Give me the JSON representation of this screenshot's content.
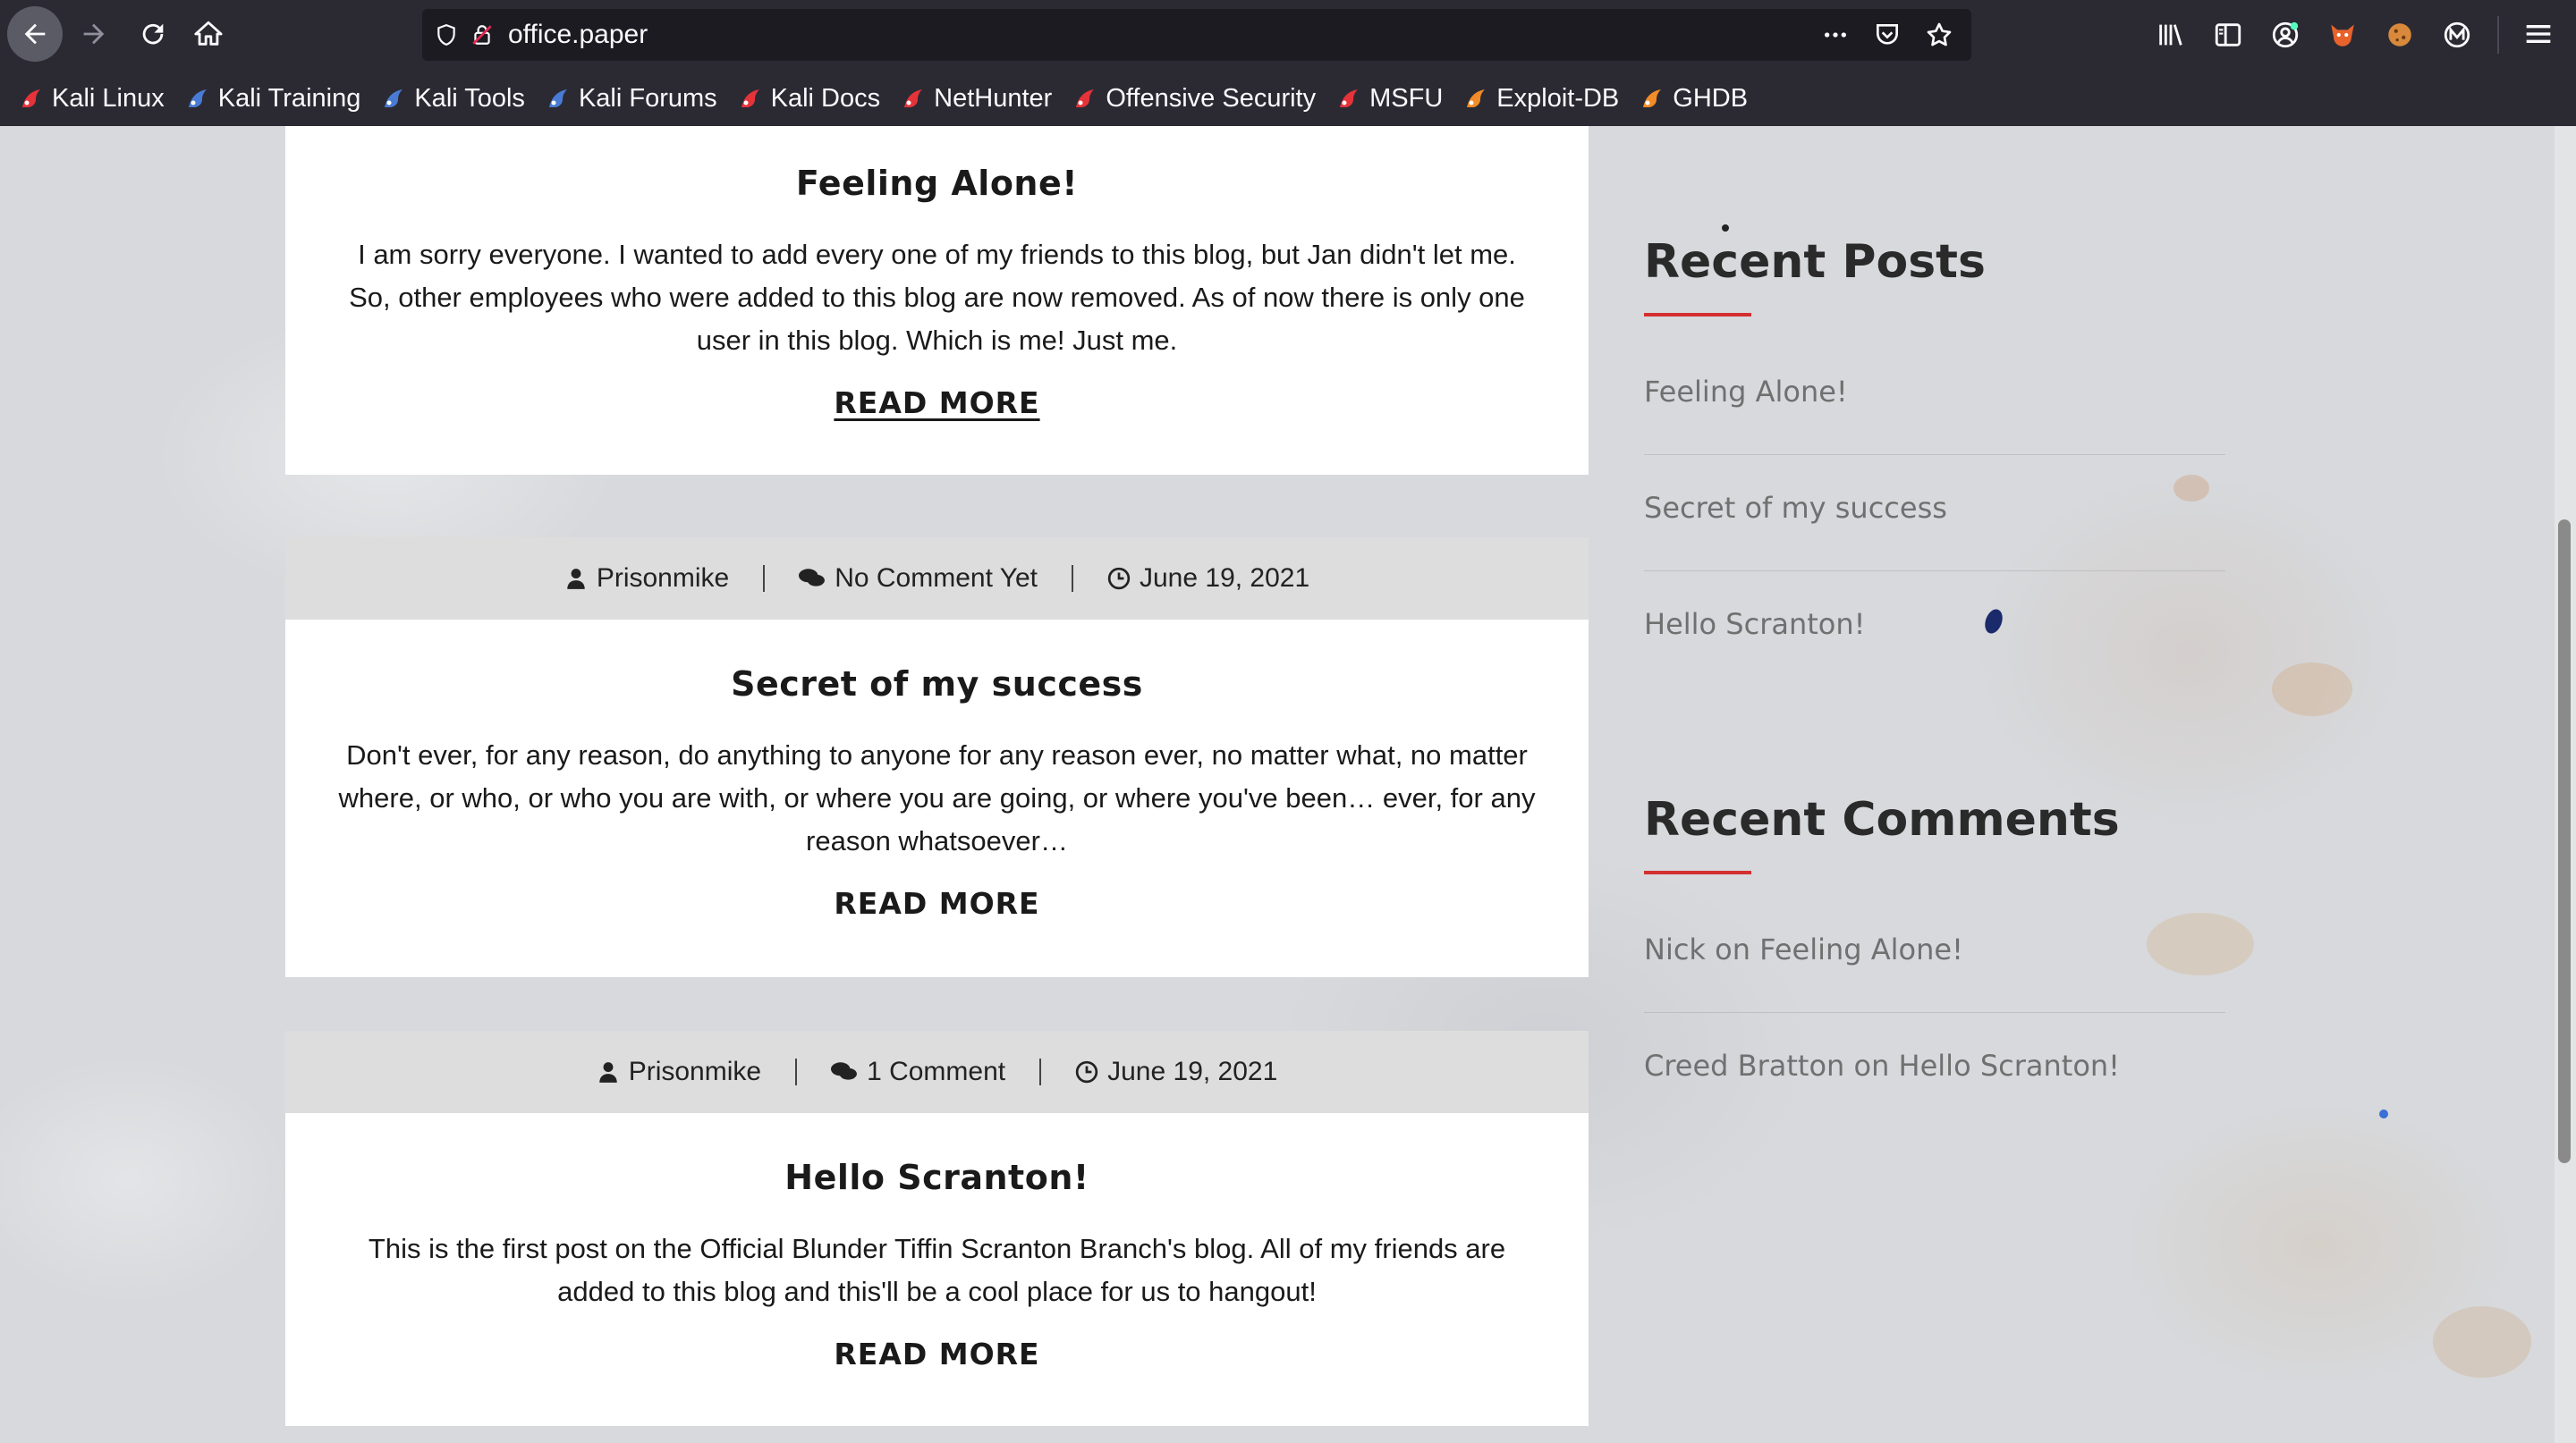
{
  "browser": {
    "url": "office.paper",
    "bookmarks": [
      {
        "label": "Kali Linux",
        "icon": "kali-dragon-icon",
        "color": "#e6333a"
      },
      {
        "label": "Kali Training",
        "icon": "kali-training-icon",
        "color": "#4a7bd4"
      },
      {
        "label": "Kali Tools",
        "icon": "kali-tools-icon",
        "color": "#4a7bd4"
      },
      {
        "label": "Kali Forums",
        "icon": "kali-forums-icon",
        "color": "#4a7bd4"
      },
      {
        "label": "Kali Docs",
        "icon": "kali-docs-icon",
        "color": "#e6333a"
      },
      {
        "label": "NetHunter",
        "icon": "nethunter-icon",
        "color": "#e6333a"
      },
      {
        "label": "Offensive Security",
        "icon": "offsec-icon",
        "color": "#e6333a"
      },
      {
        "label": "MSFU",
        "icon": "msfu-icon",
        "color": "#e6333a"
      },
      {
        "label": "Exploit-DB",
        "icon": "exploit-db-icon",
        "color": "#f28c28"
      },
      {
        "label": "GHDB",
        "icon": "ghdb-icon",
        "color": "#f28c28"
      }
    ]
  },
  "posts": [
    {
      "title": "Feeling Alone!",
      "excerpt_lines": [
        "I am sorry everyone. I wanted to add every one of my friends to this blog, but Jan didn't let me.",
        "So, other employees who were added to this blog are now removed. As of now there is only one",
        "user in this blog. Which is me! Just me."
      ],
      "read_more": "READ MORE"
    },
    {
      "author": "Prisonmike",
      "comments": "No Comment Yet",
      "date": "June 19, 2021",
      "title": "Secret of my success",
      "excerpt_lines": [
        "Don't ever, for any reason, do anything to anyone for any reason ever, no matter what, no matter",
        "where, or who, or who you are with, or where you are going, or where you've been… ever, for any",
        "reason whatsoever…"
      ],
      "read_more": "READ MORE"
    },
    {
      "author": "Prisonmike",
      "comments": "1 Comment",
      "date": "June 19, 2021",
      "title": "Hello Scranton!",
      "excerpt_lines": [
        "This is the first post on the Official Blunder Tiffin Scranton Branch's blog. All of my friends are",
        "added to this blog and this'll be a cool place for us to hangout!"
      ],
      "read_more": "READ MORE"
    }
  ],
  "sidebar": {
    "recent_posts": {
      "title": "Recent Posts",
      "items": [
        "Feeling Alone!",
        "Secret of my success",
        "Hello Scranton!"
      ]
    },
    "recent_comments": {
      "title": "Recent Comments",
      "items": [
        {
          "author": "Nick",
          "connector": " on ",
          "post": "Feeling Alone!"
        },
        {
          "author": "Creed Bratton",
          "connector": " on ",
          "post": "Hello Scranton!"
        }
      ]
    }
  },
  "colors": {
    "accent": "#d32f2f",
    "chrome_bg": "#2b2a33",
    "urlbar_bg": "#1c1b22"
  }
}
